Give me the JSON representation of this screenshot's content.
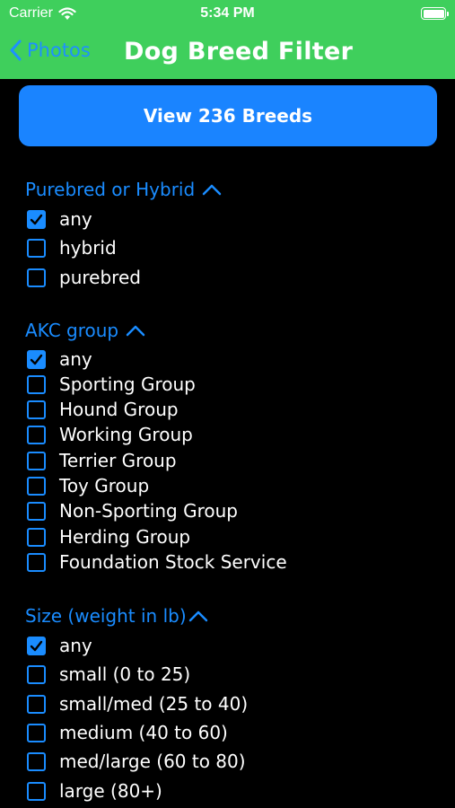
{
  "status": {
    "carrier": "Carrier",
    "time": "5:34 PM"
  },
  "nav": {
    "back_label": "Photos",
    "title": "Dog Breed Filter"
  },
  "cta": {
    "label": "View 236 Breeds"
  },
  "sections": [
    {
      "title": "Purebred or Hybrid",
      "options": [
        {
          "label": "any",
          "checked": true
        },
        {
          "label": "hybrid",
          "checked": false
        },
        {
          "label": "purebred",
          "checked": false
        }
      ]
    },
    {
      "title": "AKC group",
      "options": [
        {
          "label": "any",
          "checked": true
        },
        {
          "label": "Sporting Group",
          "checked": false
        },
        {
          "label": "Hound Group",
          "checked": false
        },
        {
          "label": "Working Group",
          "checked": false
        },
        {
          "label": "Terrier Group",
          "checked": false
        },
        {
          "label": "Toy Group",
          "checked": false
        },
        {
          "label": "Non-Sporting Group",
          "checked": false
        },
        {
          "label": "Herding Group",
          "checked": false
        },
        {
          "label": "Foundation Stock Service",
          "checked": false
        }
      ]
    },
    {
      "title": "Size (weight in lb)",
      "options": [
        {
          "label": "any",
          "checked": true
        },
        {
          "label": "small (0 to 25)",
          "checked": false
        },
        {
          "label": "small/med (25 to 40)",
          "checked": false
        },
        {
          "label": "medium (40 to 60)",
          "checked": false
        },
        {
          "label": "med/large (60 to 80)",
          "checked": false
        },
        {
          "label": "large (80+)",
          "checked": false
        }
      ]
    }
  ]
}
